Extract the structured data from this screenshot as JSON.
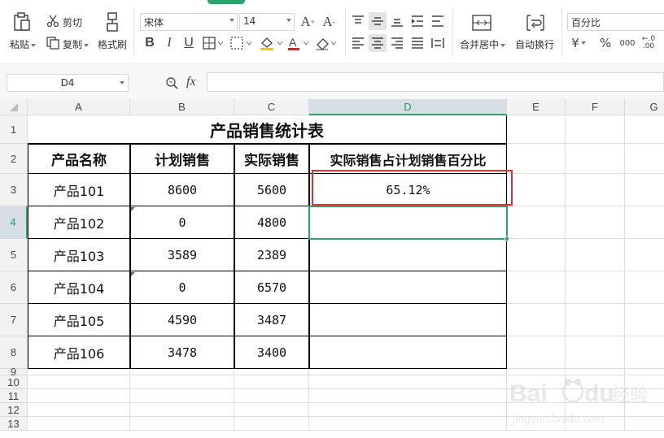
{
  "ribbon": {
    "paste_label": "粘贴",
    "cut_label": "剪切",
    "copy_label": "复制",
    "format_painter_label": "格式刷",
    "font_name": "宋体",
    "font_size": "14",
    "merge_center_label": "合并居中",
    "wrap_label": "自动换行",
    "number_format": "百分比",
    "icons": [
      "paste-icon",
      "cut-icon",
      "copy-icon",
      "format-painter-icon",
      "bold-icon",
      "italic-icon",
      "underline-icon",
      "border-icon",
      "fill-color-icon",
      "font-color-icon",
      "eraser-icon",
      "increase-font-icon",
      "decrease-font-icon",
      "align-top-icon",
      "align-middle-icon",
      "align-bottom-icon",
      "indent-icon",
      "wrap-icon",
      "align-left-icon",
      "align-center-icon",
      "align-right-icon",
      "justify-icon",
      "distribute-icon",
      "merge-icon",
      "auto-wrap-icon",
      "currency-icon",
      "percent-icon",
      "thousands-icon",
      "decimal-icon"
    ]
  },
  "formula_bar": {
    "name_box": "D4",
    "fx_label": "fx",
    "formula": ""
  },
  "sheet": {
    "columns": [
      "A",
      "B",
      "C",
      "D",
      "E",
      "F",
      "G"
    ],
    "rows": [
      "1",
      "2",
      "3",
      "4",
      "5",
      "6",
      "7",
      "8",
      "9",
      "10",
      "11",
      "12",
      "13"
    ],
    "title": "产品销售统计表",
    "headers": [
      "产品名称",
      "计划销售",
      "实际销售",
      "实际销售占计划销售百分比"
    ],
    "data": [
      [
        "产品101",
        "8600",
        "5600",
        "65.12%"
      ],
      [
        "产品102",
        "0",
        "4800",
        ""
      ],
      [
        "产品103",
        "3589",
        "2389",
        ""
      ],
      [
        "产品104",
        "0",
        "6570",
        ""
      ],
      [
        "产品105",
        "4590",
        "3487",
        ""
      ],
      [
        "产品106",
        "3478",
        "3400",
        ""
      ]
    ],
    "active_cell": "D4"
  },
  "colors": {
    "selection": "#2ea36b",
    "highlight_box": "#e0312f",
    "header_bg": "#f2f2f2"
  },
  "watermark": {
    "line1": "Baidu 经验",
    "line2": "jingyan.baidu.com"
  }
}
